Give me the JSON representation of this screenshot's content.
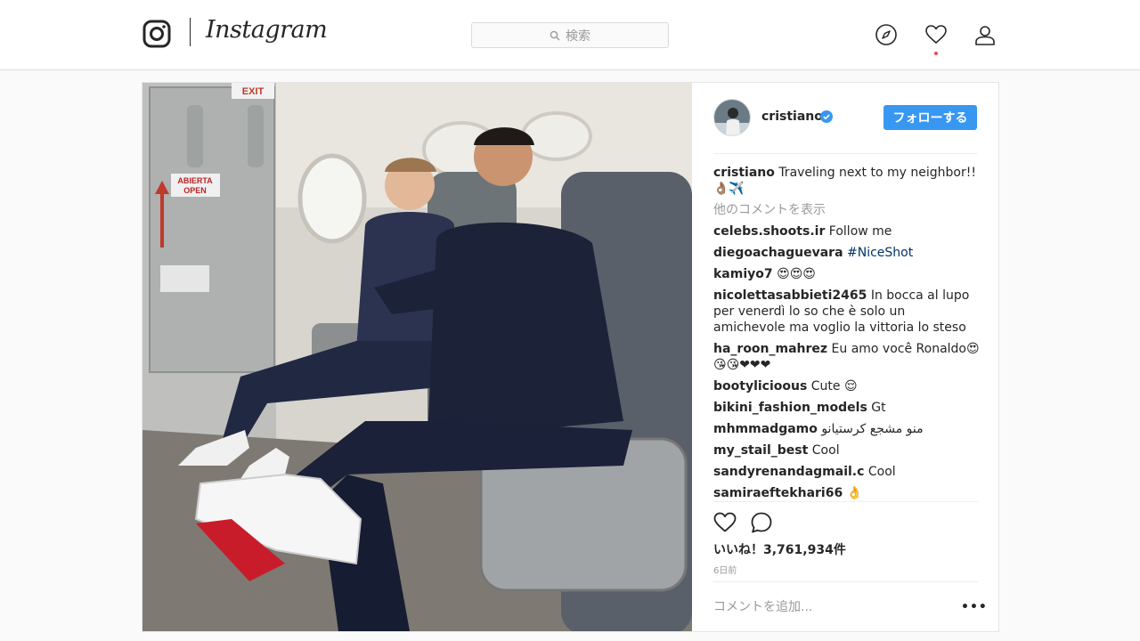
{
  "header": {
    "brand": "Instagram",
    "search_placeholder": "検索",
    "icons": [
      "instagram-glyph-icon",
      "compass-icon",
      "heart-icon",
      "user-icon"
    ]
  },
  "post": {
    "username": "cristiano",
    "follow_label": "フォローする",
    "caption_user": "cristiano",
    "caption_text": "Traveling next to my neighbor!!👌🏽✈️",
    "more_comments": "他のコメントを表示",
    "comments": [
      {
        "user": "celebs.shoots.ir",
        "text": "Follow me"
      },
      {
        "user": "diegoachaguevara",
        "text": "#NiceShot"
      },
      {
        "user": "kamiyo7",
        "text": "😍😍😍"
      },
      {
        "user": "nicolettasabbieti2465",
        "text": "In bocca al lupo per venerdì lo so che è solo un amichevole ma voglio la vittoria lo steso"
      },
      {
        "user": "ha_roon_mahrez",
        "text": "Eu amo você Ronaldo😍😘😘❤❤❤"
      },
      {
        "user": "bootylicioous",
        "text": "Cute 😌"
      },
      {
        "user": "bikini_fashion_models",
        "text": "Gt"
      },
      {
        "user": "mhmmadgamo",
        "text": "منو مشجع كرستيانو"
      },
      {
        "user": "my_stail_best",
        "text": "Cool"
      },
      {
        "user": "sandyrenandagmail.c",
        "text": "Cool"
      },
      {
        "user": "samiraeftekhari66",
        "text": "👌"
      }
    ],
    "likes": "いいね！3,761,934件",
    "time": "6日前",
    "add_comment_placeholder": "コメントを追加...",
    "more_label": "•••",
    "exit_sign": "EXIT",
    "door_sign_1": "ABIERTA",
    "door_sign_2": "OPEN"
  },
  "colors": {
    "accent": "#3897f0",
    "notification": "#ed4956",
    "verified": "#3897f0"
  }
}
